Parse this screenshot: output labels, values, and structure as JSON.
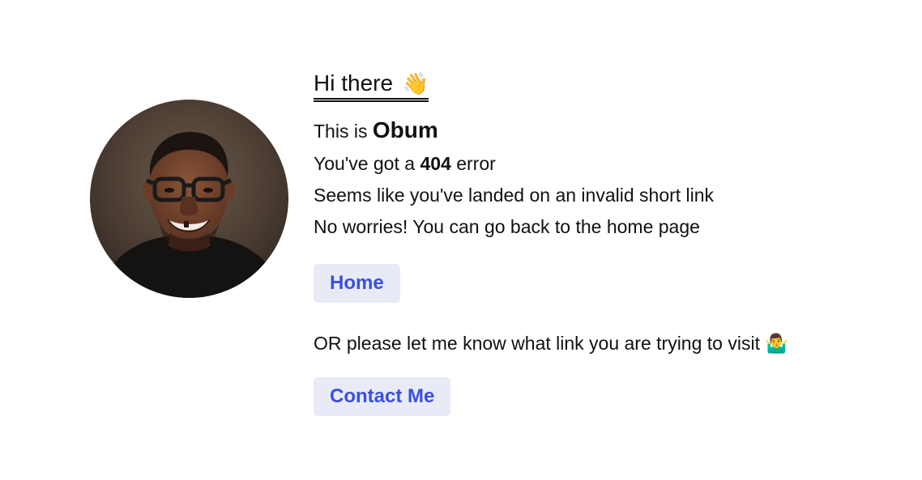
{
  "greeting": {
    "text": "Hi there",
    "emoji": "👋"
  },
  "intro": {
    "prefix": "This is",
    "name": "Obum"
  },
  "error_line": {
    "prefix": "You've got a",
    "code": "404",
    "suffix": "error"
  },
  "messages": {
    "invalid": "Seems like you've landed on an invalid short link",
    "back": "No worries! You can go back to the home page"
  },
  "buttons": {
    "home": "Home",
    "contact": "Contact Me"
  },
  "or_line": {
    "text": "OR please let me know what link you are trying to visit",
    "emoji": "🤷‍♂️"
  },
  "colors": {
    "button_bg": "#e8eaf6",
    "button_text": "#3a4fe0"
  }
}
